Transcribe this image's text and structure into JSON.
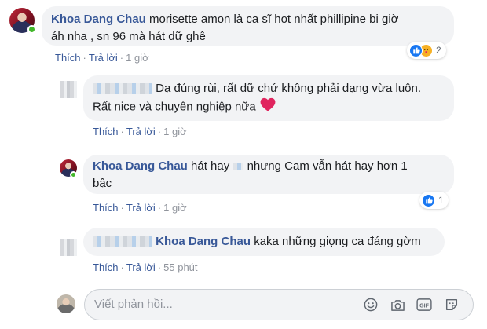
{
  "comments": [
    {
      "author": "Khoa Dang Chau",
      "text_line1": "morisette amon là ca sĩ hot nhất phillipine bi giờ",
      "text_line2": "áh nha , sn 96 mà hát dữ ghê",
      "actions": {
        "like": "Thích",
        "reply": "Trả lời",
        "time": "1 giờ"
      },
      "reactions": {
        "icons": [
          "like-icon",
          "care-icon"
        ],
        "count": "2"
      }
    },
    {
      "author": "",
      "text_line1": "Dạ đúng rùi, rất dữ chứ không phải dạng vừa luôn.",
      "text_line2": "Rất nice và chuyên nghiệp nữa",
      "actions": {
        "like": "Thích",
        "reply": "Trả lời",
        "time": "1 giờ"
      }
    },
    {
      "author": "Khoa Dang Chau",
      "text_line1a": "hát hay",
      "text_line1b": "nhưng Cam vẫn hát hay hơn 1",
      "text_line2": "bậc",
      "actions": {
        "like": "Thích",
        "reply": "Trả lời",
        "time": "1 giờ"
      },
      "reactions": {
        "icons": [
          "like-icon"
        ],
        "count": "1"
      }
    },
    {
      "author": "",
      "mention": "Khoa Dang Chau",
      "text": "kaka những giọng ca đáng gờm",
      "actions": {
        "like": "Thích",
        "reply": "Trả lời",
        "time": "55 phút"
      }
    }
  ],
  "reply_box": {
    "placeholder": "Viết phản hồi...",
    "tools": [
      "emoji-icon",
      "camera-icon",
      "gif-icon",
      "sticker-icon"
    ]
  },
  "colors": {
    "link": "#385898",
    "bubble": "#f2f3f5",
    "meta": "#90949c",
    "like": "#1877f2",
    "online": "#42b72a",
    "heart": "#e0245e"
  }
}
